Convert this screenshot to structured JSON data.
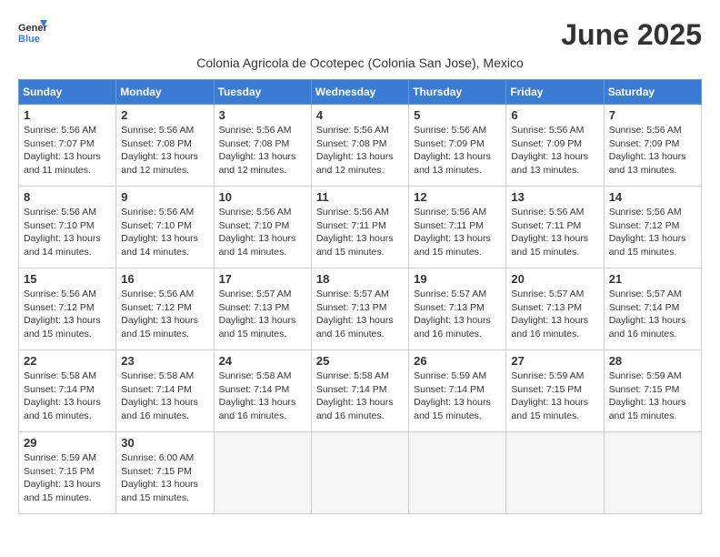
{
  "logo": {
    "general": "General",
    "blue": "Blue"
  },
  "title": "June 2025",
  "location": "Colonia Agricola de Ocotepec (Colonia San Jose), Mexico",
  "weekdays": [
    "Sunday",
    "Monday",
    "Tuesday",
    "Wednesday",
    "Thursday",
    "Friday",
    "Saturday"
  ],
  "weeks": [
    [
      {
        "day": "1",
        "sunrise": "5:56 AM",
        "sunset": "7:07 PM",
        "daylight": "13 hours and 11 minutes."
      },
      {
        "day": "2",
        "sunrise": "5:56 AM",
        "sunset": "7:08 PM",
        "daylight": "13 hours and 12 minutes."
      },
      {
        "day": "3",
        "sunrise": "5:56 AM",
        "sunset": "7:08 PM",
        "daylight": "13 hours and 12 minutes."
      },
      {
        "day": "4",
        "sunrise": "5:56 AM",
        "sunset": "7:08 PM",
        "daylight": "13 hours and 12 minutes."
      },
      {
        "day": "5",
        "sunrise": "5:56 AM",
        "sunset": "7:09 PM",
        "daylight": "13 hours and 13 minutes."
      },
      {
        "day": "6",
        "sunrise": "5:56 AM",
        "sunset": "7:09 PM",
        "daylight": "13 hours and 13 minutes."
      },
      {
        "day": "7",
        "sunrise": "5:56 AM",
        "sunset": "7:09 PM",
        "daylight": "13 hours and 13 minutes."
      }
    ],
    [
      {
        "day": "8",
        "sunrise": "5:56 AM",
        "sunset": "7:10 PM",
        "daylight": "13 hours and 14 minutes."
      },
      {
        "day": "9",
        "sunrise": "5:56 AM",
        "sunset": "7:10 PM",
        "daylight": "13 hours and 14 minutes."
      },
      {
        "day": "10",
        "sunrise": "5:56 AM",
        "sunset": "7:10 PM",
        "daylight": "13 hours and 14 minutes."
      },
      {
        "day": "11",
        "sunrise": "5:56 AM",
        "sunset": "7:11 PM",
        "daylight": "13 hours and 15 minutes."
      },
      {
        "day": "12",
        "sunrise": "5:56 AM",
        "sunset": "7:11 PM",
        "daylight": "13 hours and 15 minutes."
      },
      {
        "day": "13",
        "sunrise": "5:56 AM",
        "sunset": "7:11 PM",
        "daylight": "13 hours and 15 minutes."
      },
      {
        "day": "14",
        "sunrise": "5:56 AM",
        "sunset": "7:12 PM",
        "daylight": "13 hours and 15 minutes."
      }
    ],
    [
      {
        "day": "15",
        "sunrise": "5:56 AM",
        "sunset": "7:12 PM",
        "daylight": "13 hours and 15 minutes."
      },
      {
        "day": "16",
        "sunrise": "5:56 AM",
        "sunset": "7:12 PM",
        "daylight": "13 hours and 15 minutes."
      },
      {
        "day": "17",
        "sunrise": "5:57 AM",
        "sunset": "7:13 PM",
        "daylight": "13 hours and 15 minutes."
      },
      {
        "day": "18",
        "sunrise": "5:57 AM",
        "sunset": "7:13 PM",
        "daylight": "13 hours and 16 minutes."
      },
      {
        "day": "19",
        "sunrise": "5:57 AM",
        "sunset": "7:13 PM",
        "daylight": "13 hours and 16 minutes."
      },
      {
        "day": "20",
        "sunrise": "5:57 AM",
        "sunset": "7:13 PM",
        "daylight": "13 hours and 16 minutes."
      },
      {
        "day": "21",
        "sunrise": "5:57 AM",
        "sunset": "7:14 PM",
        "daylight": "13 hours and 16 minutes."
      }
    ],
    [
      {
        "day": "22",
        "sunrise": "5:58 AM",
        "sunset": "7:14 PM",
        "daylight": "13 hours and 16 minutes."
      },
      {
        "day": "23",
        "sunrise": "5:58 AM",
        "sunset": "7:14 PM",
        "daylight": "13 hours and 16 minutes."
      },
      {
        "day": "24",
        "sunrise": "5:58 AM",
        "sunset": "7:14 PM",
        "daylight": "13 hours and 16 minutes."
      },
      {
        "day": "25",
        "sunrise": "5:58 AM",
        "sunset": "7:14 PM",
        "daylight": "13 hours and 16 minutes."
      },
      {
        "day": "26",
        "sunrise": "5:59 AM",
        "sunset": "7:14 PM",
        "daylight": "13 hours and 15 minutes."
      },
      {
        "day": "27",
        "sunrise": "5:59 AM",
        "sunset": "7:15 PM",
        "daylight": "13 hours and 15 minutes."
      },
      {
        "day": "28",
        "sunrise": "5:59 AM",
        "sunset": "7:15 PM",
        "daylight": "13 hours and 15 minutes."
      }
    ],
    [
      {
        "day": "29",
        "sunrise": "5:59 AM",
        "sunset": "7:15 PM",
        "daylight": "13 hours and 15 minutes."
      },
      {
        "day": "30",
        "sunrise": "6:00 AM",
        "sunset": "7:15 PM",
        "daylight": "13 hours and 15 minutes."
      },
      null,
      null,
      null,
      null,
      null
    ]
  ]
}
